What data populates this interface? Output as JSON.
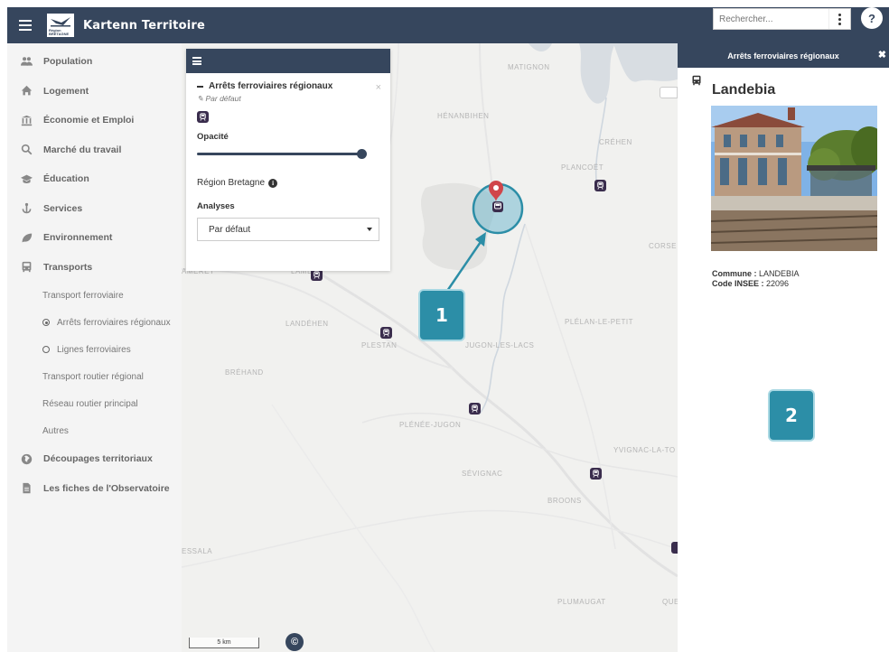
{
  "header": {
    "title": "Kartenn Territoire",
    "logo_text_line1": "Région",
    "logo_text_line2": "BRETAGNE",
    "search_placeholder": "Rechercher...",
    "help_label": "?"
  },
  "sidebar": {
    "items": [
      {
        "label": "Population",
        "icon": "users-icon"
      },
      {
        "label": "Logement",
        "icon": "home-icon"
      },
      {
        "label": "Économie et Emploi",
        "icon": "bank-icon"
      },
      {
        "label": "Marché du travail",
        "icon": "search-icon"
      },
      {
        "label": "Éducation",
        "icon": "graduation-cap-icon"
      },
      {
        "label": "Services",
        "icon": "anchor-icon"
      },
      {
        "label": "Environnement",
        "icon": "leaf-icon"
      },
      {
        "label": "Transports",
        "icon": "bus-icon"
      }
    ],
    "sub_items": [
      {
        "label": "Transport ferroviaire"
      },
      {
        "label": "Arrêts ferroviaires régionaux",
        "selected": true
      },
      {
        "label": "Lignes ferroviaires",
        "selected": false
      },
      {
        "label": "Transport routier régional"
      },
      {
        "label": "Réseau routier principal"
      },
      {
        "label": "Autres"
      }
    ],
    "bottom_items": [
      {
        "label": "Découpages territoriaux",
        "icon": "globe-icon"
      },
      {
        "label": "Les fiches de l'Observatoire",
        "icon": "file-icon"
      }
    ]
  },
  "layer_panel": {
    "layer_title": "Arrêts ferroviaires régionaux",
    "style_label": "Par défaut",
    "opacity_label": "Opacité",
    "opacity_value": 1.0,
    "source_label": "Région Bretagne",
    "analyses_label": "Analyses",
    "analyses_selected": "Par défaut",
    "close_label": "×"
  },
  "map": {
    "places": [
      "MATIGNON",
      "HÉNANBIHEN",
      "CRÉHEN",
      "PLANCOËT",
      "CORSE",
      "LANDÉHEN",
      "PLESTAN",
      "JUGON-LES-LACS",
      "PLÉLAN-LE-PETIT",
      "BRÉHAND",
      "PLÉNÉE-JUGON",
      "YVIGNAC-LA-TO",
      "SÉVIGNAC",
      "BROONS",
      "ESSALA",
      "PLUMAUGAT",
      "QUE",
      "AMERET",
      "LAMB"
    ],
    "scale_label": "5 km",
    "copyright_label": "©"
  },
  "right_panel": {
    "header": "Arrêts ferroviaires régionaux",
    "close_label": "✖",
    "title": "Landebia",
    "commune_label": "Commune :",
    "commune_value": "LANDEBIA",
    "insee_label": "Code INSEE :",
    "insee_value": "22096"
  },
  "callouts": {
    "one": "1",
    "two": "2"
  },
  "colors": {
    "header_bg": "#36465d",
    "station_marker": "#3a2d4d",
    "callout": "#2c8ea7",
    "pin": "#d0454a"
  }
}
